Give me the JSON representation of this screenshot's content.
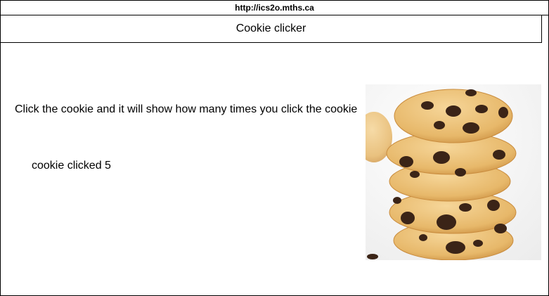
{
  "url": "http://ics2o.mths.ca",
  "header": {
    "title": "Cookie clicker"
  },
  "instructions": "Click the cookie and it will show how many times you click the cookie",
  "counter": {
    "text": "cookie clicked 5",
    "count": 5
  },
  "cookie": {
    "icon": "cookie-stack-image"
  },
  "colors": {
    "dough": "#e8b96a",
    "dough_light": "#f2cf8a",
    "chip": "#3b2417",
    "background": "#ffffff"
  }
}
